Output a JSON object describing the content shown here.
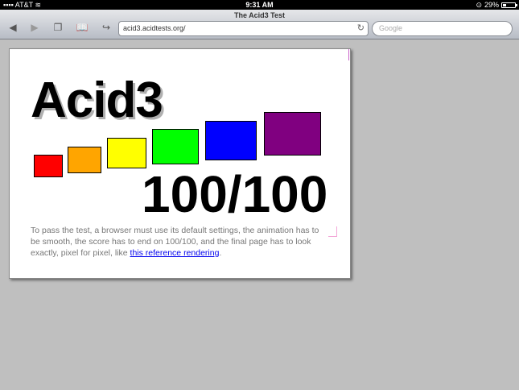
{
  "status": {
    "carrier": "AT&T",
    "time": "9:31 AM",
    "battery": "29%",
    "battery_level": 0.29
  },
  "browser": {
    "page_title": "The Acid3 Test",
    "url": "acid3.acidtests.org/",
    "search_placeholder": "Google"
  },
  "content": {
    "heading": "Acid3",
    "score": "100/100",
    "description": "To pass the test, a browser must use its default settings, the animation has to be smooth, the score has to end on 100/100, and the final page has to look exactly, pixel for pixel, like ",
    "link": "this reference rendering",
    "period": ".",
    "boxes": [
      {
        "color": "#ff0000"
      },
      {
        "color": "#ffa500"
      },
      {
        "color": "#ffff00"
      },
      {
        "color": "#00ff00"
      },
      {
        "color": "#0000ff"
      },
      {
        "color": "#800080"
      }
    ]
  }
}
